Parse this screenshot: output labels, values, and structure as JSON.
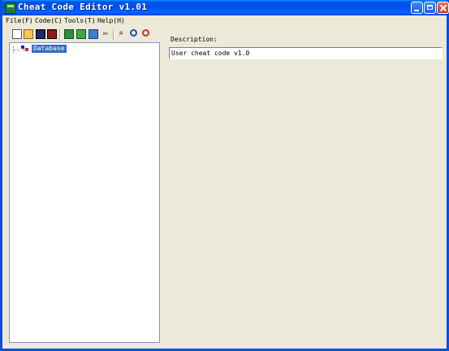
{
  "window": {
    "title": "Cheat Code Editor v1.01"
  },
  "menu": {
    "file": "File(F)",
    "code": "Code(C)",
    "tools": "Tools(T)",
    "help": "Help(H)"
  },
  "toolbar": {
    "icons": [
      "new-icon",
      "open-icon",
      "save-icon",
      "save-as-icon",
      "mail-icon",
      "mail-send-icon",
      "mail-edit-icon",
      "cut-icon",
      "binoculars-icon",
      "find-icon",
      "find-next-icon"
    ]
  },
  "tree": {
    "root_label": "Database"
  },
  "description": {
    "label": "Description:",
    "value": "User cheat code v1.0"
  }
}
